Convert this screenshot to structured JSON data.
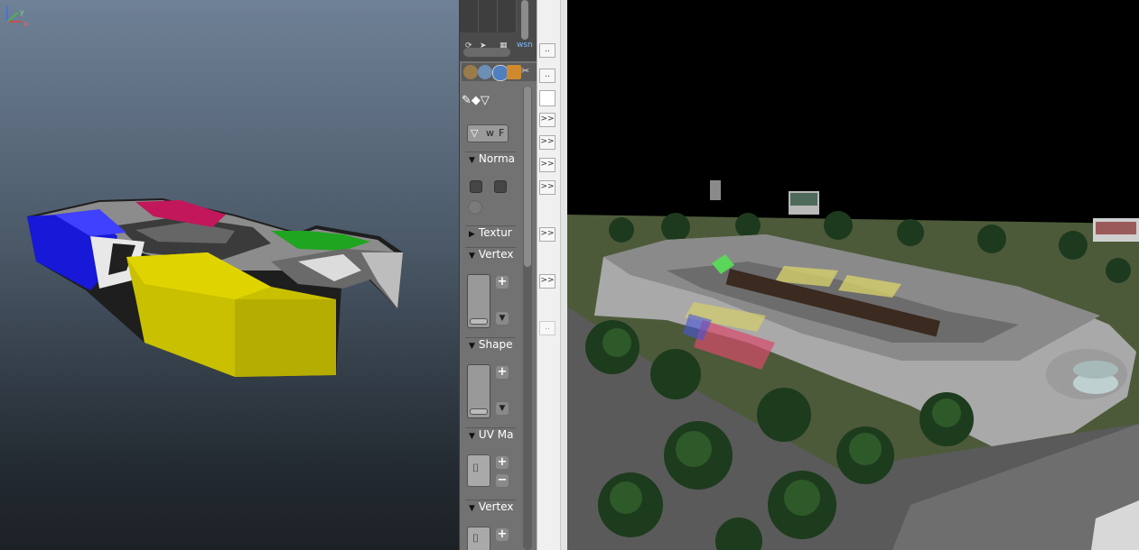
{
  "viewport_left": {
    "axis_labels": {
      "y": "y",
      "x": "x"
    }
  },
  "props_panel": {
    "top_label": "wsn",
    "dots_label": "..",
    "panels": [
      {
        "title": "Norma",
        "expanded": true
      },
      {
        "title": "Textur",
        "expanded": false
      },
      {
        "title": "Vertex",
        "expanded": true
      },
      {
        "title": "Shape",
        "expanded": true
      },
      {
        "title": "UV Ma",
        "expanded": true
      },
      {
        "title": "Vertex",
        "expanded": true
      }
    ],
    "wire_label": "w",
    "face_label": "F",
    "plus": "+",
    "minus": "−"
  },
  "button_column": {
    "dots": "..",
    "expand": ">>"
  },
  "colors": {
    "panel_bg": "#727272",
    "viewport_top": "#6f8196",
    "viewport_bottom": "#1c2126",
    "wsn_text": "#7fb8ff"
  }
}
